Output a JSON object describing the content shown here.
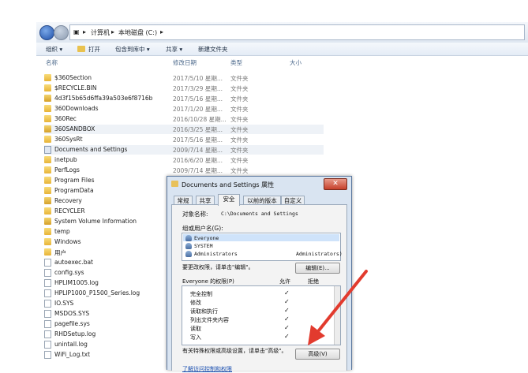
{
  "address": {
    "crumbs": [
      "计算机",
      "本地磁盘 (C:)"
    ],
    "sep": "▸"
  },
  "toolbar": {
    "organize": "组织 ▾",
    "open": "打开",
    "include": "包含到库中 ▾",
    "share": "共享 ▾",
    "newfolder": "新建文件夹"
  },
  "columns": {
    "name": "名称",
    "date": "修改日期",
    "type": "类型",
    "size": "大小"
  },
  "files": [
    {
      "name": "$360Section",
      "date": "2017/5/10 星期...",
      "type": "文件夹",
      "icon": "folder"
    },
    {
      "name": "$RECYCLE.BIN",
      "date": "2017/3/29 星期...",
      "type": "文件夹",
      "icon": "folder"
    },
    {
      "name": "4d3f15b65d6ffa39a503e6f8716b",
      "date": "2017/5/16 星期...",
      "type": "文件夹",
      "icon": "folder-lock"
    },
    {
      "name": "360Downloads",
      "date": "2017/1/20 星期...",
      "type": "文件夹",
      "icon": "folder"
    },
    {
      "name": "360Rec",
      "date": "2016/10/28 星期...",
      "type": "文件夹",
      "icon": "folder"
    },
    {
      "name": "360SANDBOX",
      "date": "2016/3/25 星期...",
      "type": "文件夹",
      "icon": "folder-lock"
    },
    {
      "name": "360SysRt",
      "date": "2017/5/16 星期...",
      "type": "文件夹",
      "icon": "folder"
    },
    {
      "name": "Documents and Settings",
      "date": "2009/7/14 星期...",
      "type": "文件夹",
      "icon": "link"
    },
    {
      "name": "inetpub",
      "date": "2016/6/20 星期...",
      "type": "文件夹",
      "icon": "folder"
    },
    {
      "name": "PerfLogs",
      "date": "2009/7/14 星期...",
      "type": "文件夹",
      "icon": "folder"
    },
    {
      "name": "Program Files",
      "date": "",
      "type": "",
      "icon": "folder"
    },
    {
      "name": "ProgramData",
      "date": "",
      "type": "",
      "icon": "folder"
    },
    {
      "name": "Recovery",
      "date": "",
      "type": "",
      "icon": "folder-lock"
    },
    {
      "name": "RECYCLER",
      "date": "",
      "type": "",
      "icon": "folder"
    },
    {
      "name": "System Volume Information",
      "date": "",
      "type": "",
      "icon": "folder-lock"
    },
    {
      "name": "temp",
      "date": "",
      "type": "",
      "icon": "folder"
    },
    {
      "name": "Windows",
      "date": "",
      "type": "",
      "icon": "folder"
    },
    {
      "name": "用户",
      "date": "",
      "type": "",
      "icon": "folder"
    },
    {
      "name": "autoexec.bat",
      "date": "",
      "type": "",
      "icon": "file"
    },
    {
      "name": "config.sys",
      "date": "",
      "type": "",
      "icon": "file"
    },
    {
      "name": "HPLIM1005.log",
      "date": "",
      "type": "",
      "icon": "file"
    },
    {
      "name": "HPLIP1000_P1500_Series.log",
      "date": "",
      "type": "",
      "icon": "file"
    },
    {
      "name": "IO.SYS",
      "date": "",
      "type": "",
      "icon": "file"
    },
    {
      "name": "MSDOS.SYS",
      "date": "",
      "type": "",
      "icon": "file"
    },
    {
      "name": "pagefile.sys",
      "date": "",
      "type": "",
      "icon": "file"
    },
    {
      "name": "RHDSetup.log",
      "date": "",
      "type": "",
      "icon": "file"
    },
    {
      "name": "unintall.log",
      "date": "",
      "type": "",
      "icon": "file"
    },
    {
      "name": "WiFi_Log.txt",
      "date": "",
      "type": "",
      "icon": "file"
    }
  ],
  "dialog": {
    "title": "Documents and Settings 属性",
    "close": "✕",
    "tabs": [
      "常规",
      "共享",
      "安全",
      "以前的版本",
      "自定义"
    ],
    "object_label": "对象名称:",
    "object_value": "C:\\Documents and Settings",
    "groups_label": "组或用户名(G):",
    "users": [
      "Everyone",
      "SYSTEM",
      "Administrators"
    ],
    "users_extra": "Administrators)",
    "change_hint": "要更改权限，请单击\"编辑\"。",
    "edit_button": "编辑(E)...",
    "perm_header": "Everyone 的权限(P)",
    "allow": "允许",
    "deny": "拒绝",
    "permissions": [
      "完全控制",
      "修改",
      "读取和执行",
      "列出文件夹内容",
      "读取",
      "写入"
    ],
    "special_hint": "有关特殊权限或高级设置，请单击\"高级\"。",
    "advanced_button": "高级(V)",
    "learn_link": "了解访问控制和权限"
  }
}
